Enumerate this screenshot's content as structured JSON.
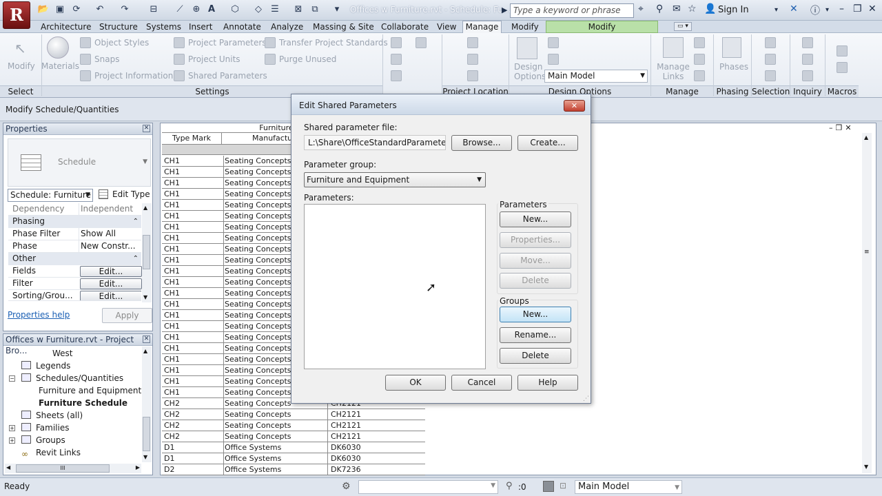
{
  "window": {
    "title": "Offices w Furniture.rvt - Schedule: Fu...",
    "search_placeholder": "Type a keyword or phrase",
    "signin": "Sign In",
    "app_letter": "R"
  },
  "tabs": [
    "Architecture",
    "Structure",
    "Systems",
    "Insert",
    "Annotate",
    "Analyze",
    "Massing & Site",
    "Collaborate",
    "View",
    "Manage",
    "Modify",
    "Modify Schedule/Quantities"
  ],
  "ribbon": {
    "modify": "Modify",
    "materials": "Materials",
    "object_styles": "Object  Styles",
    "snaps": "Snaps",
    "project_information": "Project  Information",
    "project_parameters": "Project  Parameters",
    "project_units": "Project  Units",
    "shared_parameters": "Shared  Parameters",
    "transfer_standards": "Transfer  Project Standards",
    "purge_unused": "Purge  Unused",
    "design_options": "Design Options",
    "main_model": "Main Model",
    "manage_links": "Manage Links",
    "phases": "Phases",
    "panels": {
      "select": "Select",
      "settings": "Settings",
      "project_location": "Project Location",
      "design_options": "Design Options",
      "manage_project": "Manage Project",
      "phasing": "Phasing",
      "selection": "Selection",
      "inquiry": "Inquiry",
      "macros": "Macros"
    }
  },
  "optbar": {
    "label": "Modify Schedule/Quantities"
  },
  "properties": {
    "title": "Properties",
    "type_name": "Schedule",
    "selector": "Schedule: Furniture",
    "edit_type": "Edit Type",
    "rows": [
      {
        "k": "Dependency",
        "v": "Independent"
      }
    ],
    "group_phasing": "Phasing",
    "phase_filter": "Phase Filter",
    "phase_filter_v": "Show All",
    "phase": "Phase",
    "phase_v": "New Constr...",
    "group_other": "Other",
    "fields": "Fields",
    "filter": "Filter",
    "sorting": "Sorting/Grou...",
    "edit": "Edit...",
    "help": "Properties help",
    "apply": "Apply"
  },
  "browser": {
    "title": "Offices w Furniture.rvt - Project Bro...",
    "items": [
      "West",
      "Legends",
      "Schedules/Quantities",
      "Furniture and Equipment Sch",
      "Furniture Schedule",
      "Sheets (all)",
      "Families",
      "Groups",
      "Revit Links"
    ],
    "scroll_thumb": "III"
  },
  "schedule": {
    "title": "Furniture",
    "headers": [
      "Type Mark",
      "Manufacturer"
    ],
    "rows": [
      [
        "CH1",
        "Seating Concepts",
        ""
      ],
      [
        "CH1",
        "Seating Concepts",
        ""
      ],
      [
        "CH1",
        "Seating Concepts",
        ""
      ],
      [
        "CH1",
        "Seating Concepts",
        ""
      ],
      [
        "CH1",
        "Seating Concepts",
        ""
      ],
      [
        "CH1",
        "Seating Concepts",
        ""
      ],
      [
        "CH1",
        "Seating Concepts",
        ""
      ],
      [
        "CH1",
        "Seating Concepts",
        ""
      ],
      [
        "CH1",
        "Seating Concepts",
        ""
      ],
      [
        "CH1",
        "Seating Concepts",
        ""
      ],
      [
        "CH1",
        "Seating Concepts",
        ""
      ],
      [
        "CH1",
        "Seating Concepts",
        ""
      ],
      [
        "CH1",
        "Seating Concepts",
        ""
      ],
      [
        "CH1",
        "Seating Concepts",
        ""
      ],
      [
        "CH1",
        "Seating Concepts",
        ""
      ],
      [
        "CH1",
        "Seating Concepts",
        ""
      ],
      [
        "CH1",
        "Seating Concepts",
        ""
      ],
      [
        "CH1",
        "Seating Concepts",
        ""
      ],
      [
        "CH1",
        "Seating Concepts",
        ""
      ],
      [
        "CH1",
        "Seating Concepts",
        ""
      ],
      [
        "CH1",
        "Seating Concepts",
        ""
      ],
      [
        "CH1",
        "Seating Concepts",
        ""
      ],
      [
        "CH2",
        "Seating Concepts",
        "CH2121"
      ],
      [
        "CH2",
        "Seating Concepts",
        "CH2121"
      ],
      [
        "CH2",
        "Seating Concepts",
        "CH2121"
      ],
      [
        "CH2",
        "Seating Concepts",
        "CH2121"
      ],
      [
        "D1",
        "Office Systems",
        "DK6030"
      ],
      [
        "D1",
        "Office Systems",
        "DK6030"
      ],
      [
        "D2",
        "Office Systems",
        "DK7236"
      ]
    ]
  },
  "status": {
    "ready": "Ready",
    "zero": ":0",
    "model": "Main Model"
  },
  "dialog": {
    "title": "Edit Shared Parameters",
    "file_label": "Shared parameter file:",
    "file_value": "L:\\Share\\OfficeStandardParameters.txt",
    "browse": "Browse...",
    "create": "Create...",
    "group_label": "Parameter group:",
    "group_value": "Furniture and Equipment",
    "params_label": "Parameters:",
    "parameters_section": "Parameters",
    "new": "New...",
    "properties": "Properties...",
    "move": "Move...",
    "delete": "Delete",
    "groups_section": "Groups",
    "rename": "Rename...",
    "ok": "OK",
    "cancel": "Cancel",
    "help": "Help"
  }
}
